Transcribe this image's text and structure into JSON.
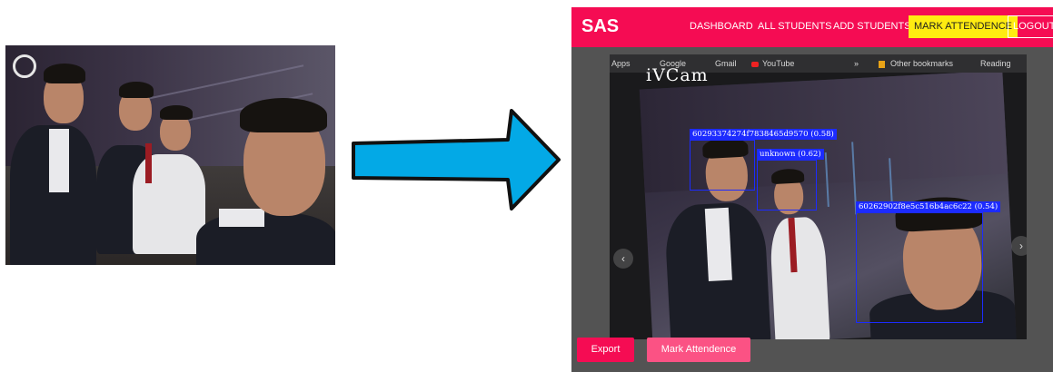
{
  "arrow": {
    "color": "#03a9e6",
    "outline": "#111111"
  },
  "app": {
    "brand": "SAS",
    "nav": {
      "dashboard": "DASHBOARD",
      "all_students": "ALL STUDENTS",
      "add_students": "ADD STUDENTS",
      "mark_attendence": "MARK ATTENDENCE",
      "logout": "LOGOUT"
    },
    "colors": {
      "primary": "#f50c53",
      "active": "#ffec11",
      "panel": "#535353",
      "box": "#1c2bff"
    },
    "capture": {
      "bookmarks": {
        "apps": "Apps",
        "google": "Google",
        "gmail": "Gmail",
        "youtube": "YouTube",
        "more": "»",
        "other_bookmarks": "Other bookmarks",
        "reading": "Reading"
      },
      "watermark": "iVCam",
      "detections": [
        {
          "label": "60293374274f7838465d9570 (0.58)"
        },
        {
          "label": "unknown (0.62)"
        },
        {
          "label": "60262902f8e5c516b4ac6c22 (0.54)"
        }
      ],
      "prev_icon": "‹",
      "next_icon": "›"
    },
    "buttons": {
      "export": "Export",
      "mark_attendence": "Mark Attendence"
    }
  }
}
